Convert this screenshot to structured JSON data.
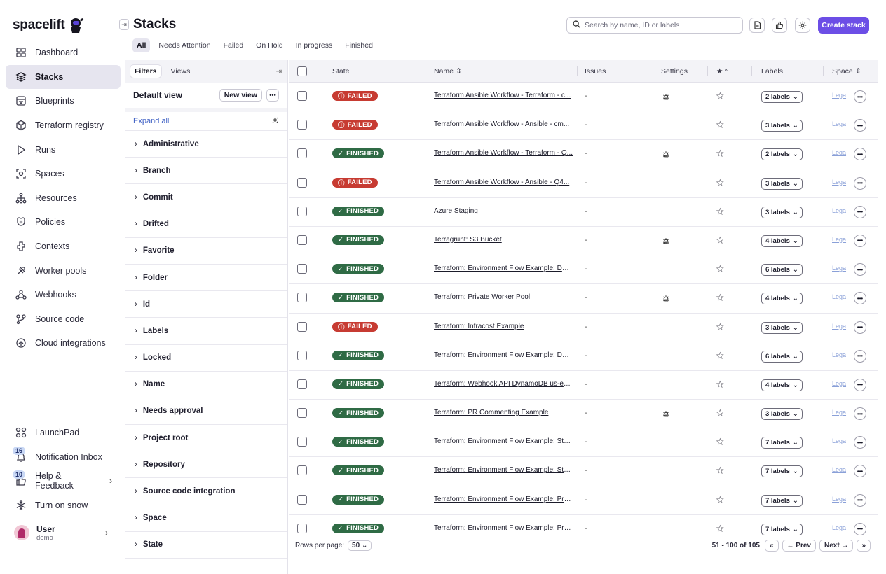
{
  "app": {
    "logo_text": "spacelift",
    "page_title": "Stacks"
  },
  "sidebar": {
    "items": [
      {
        "label": "Dashboard",
        "icon": "dashboard-icon",
        "active": false
      },
      {
        "label": "Stacks",
        "icon": "stacks-icon",
        "active": true
      },
      {
        "label": "Blueprints",
        "icon": "blueprints-icon",
        "active": false
      },
      {
        "label": "Terraform registry",
        "icon": "cube-icon",
        "active": false
      },
      {
        "label": "Runs",
        "icon": "play-icon",
        "active": false
      },
      {
        "label": "Spaces",
        "icon": "spaces-icon",
        "active": false
      },
      {
        "label": "Resources",
        "icon": "resources-icon",
        "active": false
      },
      {
        "label": "Policies",
        "icon": "policies-icon",
        "active": false
      },
      {
        "label": "Contexts",
        "icon": "contexts-icon",
        "active": false
      },
      {
        "label": "Worker pools",
        "icon": "worker-pools-icon",
        "active": false
      },
      {
        "label": "Webhooks",
        "icon": "webhooks-icon",
        "active": false
      },
      {
        "label": "Source code",
        "icon": "source-code-icon",
        "active": false
      },
      {
        "label": "Cloud integrations",
        "icon": "cloud-icon",
        "active": false
      }
    ],
    "bottom": {
      "launchpad": "LaunchPad",
      "notification_inbox": "Notification Inbox",
      "notification_count": "16",
      "help_feedback": "Help & Feedback",
      "help_count": "10",
      "snow": "Turn on snow",
      "user_name": "User",
      "user_sub": "demo"
    }
  },
  "header": {
    "search_placeholder": "Search by name, ID or labels",
    "create_button": "Create stack",
    "tabs": [
      "All",
      "Needs Attention",
      "Failed",
      "On Hold",
      "In progress",
      "Finished"
    ],
    "active_tab": "All"
  },
  "filters": {
    "tab_filters": "Filters",
    "tab_views": "Views",
    "default_view": "Default view",
    "new_view": "New view",
    "expand_all": "Expand all",
    "items": [
      "Administrative",
      "Branch",
      "Commit",
      "Drifted",
      "Favorite",
      "Folder",
      "Id",
      "Labels",
      "Locked",
      "Name",
      "Needs approval",
      "Project root",
      "Repository",
      "Source code integration",
      "Space",
      "State"
    ]
  },
  "table": {
    "headers": {
      "state": "State",
      "name": "Name",
      "issues": "Issues",
      "settings": "Settings",
      "labels": "Labels",
      "space": "Space"
    },
    "rows": [
      {
        "state": "FAILED",
        "name": "Terraform Ansible Workflow - Terraform - c...",
        "issues": "-",
        "settings": true,
        "labels": "2 labels",
        "space": "Lega"
      },
      {
        "state": "FAILED",
        "name": "Terraform Ansible Workflow - Ansible - cm...",
        "issues": "-",
        "settings": false,
        "labels": "3 labels",
        "space": "Lega"
      },
      {
        "state": "FINISHED",
        "name": "Terraform Ansible Workflow - Terraform - Q...",
        "issues": "-",
        "settings": true,
        "labels": "2 labels",
        "space": "Lega"
      },
      {
        "state": "FAILED",
        "name": "Terraform Ansible Workflow - Ansible - Q4...",
        "issues": "-",
        "settings": false,
        "labels": "3 labels",
        "space": "Lega"
      },
      {
        "state": "FINISHED",
        "name": "Azure Staging",
        "issues": "-",
        "settings": false,
        "labels": "3 labels",
        "space": "Lega"
      },
      {
        "state": "FINISHED",
        "name": "Terragrunt: S3 Bucket",
        "issues": "-",
        "settings": true,
        "labels": "4 labels",
        "space": "Lega"
      },
      {
        "state": "FINISHED",
        "name": "Terraform: Environment Flow Example: Dev...",
        "issues": "-",
        "settings": false,
        "labels": "6 labels",
        "space": "Lega"
      },
      {
        "state": "FINISHED",
        "name": "Terraform: Private Worker Pool",
        "issues": "-",
        "settings": true,
        "labels": "4 labels",
        "space": "Lega"
      },
      {
        "state": "FAILED",
        "name": "Terraform: Infracost Example",
        "issues": "-",
        "settings": false,
        "labels": "3 labels",
        "space": "Lega"
      },
      {
        "state": "FINISHED",
        "name": "Terraform: Environment Flow Example: Dev...",
        "issues": "-",
        "settings": false,
        "labels": "6 labels",
        "space": "Lega"
      },
      {
        "state": "FINISHED",
        "name": "Terraform: Webhook API DynamoDB us-eas...",
        "issues": "-",
        "settings": false,
        "labels": "4 labels",
        "space": "Lega"
      },
      {
        "state": "FINISHED",
        "name": "Terraform: PR Commenting Example",
        "issues": "-",
        "settings": true,
        "labels": "3 labels",
        "space": "Lega"
      },
      {
        "state": "FINISHED",
        "name": "Terraform: Environment Flow Example: Stag...",
        "issues": "-",
        "settings": false,
        "labels": "7 labels",
        "space": "Lega"
      },
      {
        "state": "FINISHED",
        "name": "Terraform: Environment Flow Example: Stag...",
        "issues": "-",
        "settings": false,
        "labels": "7 labels",
        "space": "Lega"
      },
      {
        "state": "FINISHED",
        "name": "Terraform: Environment Flow Example: Prod...",
        "issues": "-",
        "settings": false,
        "labels": "7 labels",
        "space": "Lega"
      },
      {
        "state": "FINISHED",
        "name": "Terraform: Environment Flow Example: Prod...",
        "issues": "-",
        "settings": false,
        "labels": "7 labels",
        "space": "Lega"
      }
    ]
  },
  "footer": {
    "rows_per_page_label": "Rows per page:",
    "rows_per_page_value": "50",
    "range": "51 - 100 of 105",
    "prev": "Prev",
    "next": "Next"
  },
  "colors": {
    "accent": "#6c4ee6",
    "failed": "#c73b32",
    "finished": "#2f6b45",
    "active_bg": "#e6e5ef"
  }
}
